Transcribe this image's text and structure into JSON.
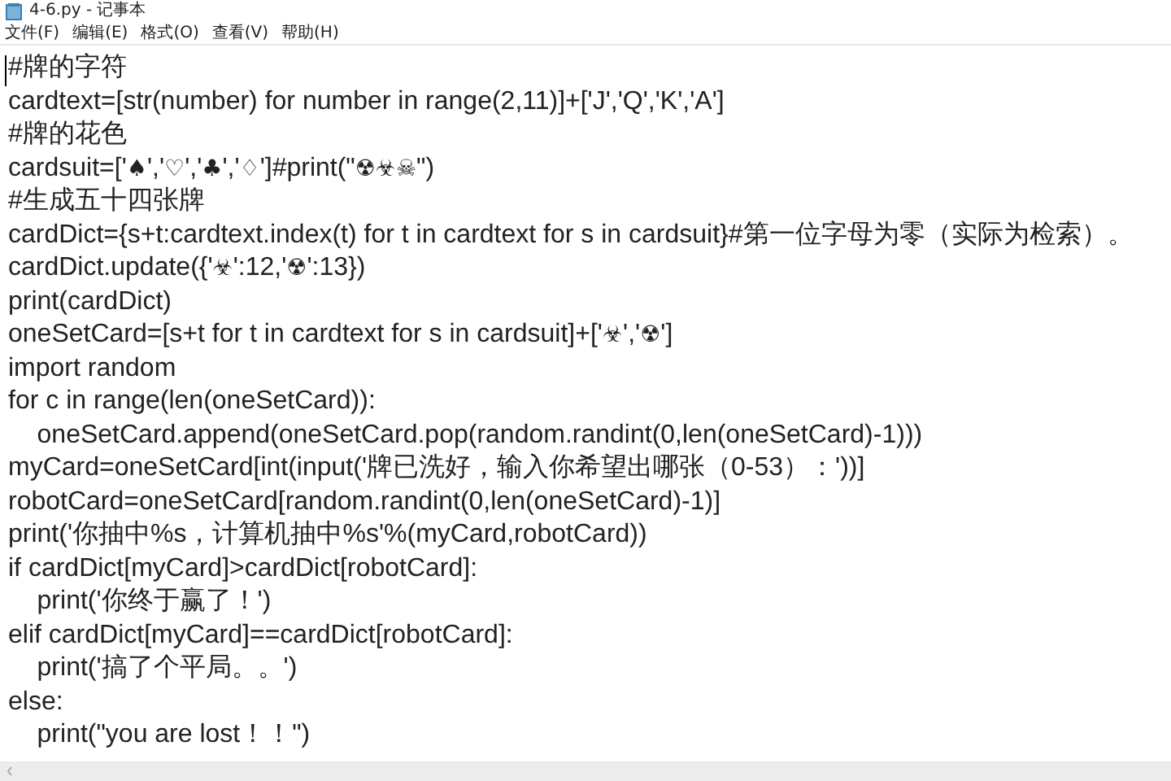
{
  "window": {
    "title": "4-6.py - 记事本"
  },
  "menu": [
    "文件(F)",
    "编辑(E)",
    "格式(O)",
    "查看(V)",
    "帮助(H)"
  ],
  "editor": {
    "lines": [
      "#牌的字符",
      "cardtext=[str(number) for number in range(2,11)]+['J','Q','K','A']",
      "#牌的花色",
      "cardsuit=['♠','♡','♣','♢']#print(\"☢☣☠\")",
      "#生成五十四张牌",
      "cardDict={s+t:cardtext.index(t) for t in cardtext for s in cardsuit}#第一位字母为零（实际为检索）。",
      "cardDict.update({'☣':12,'☢':13})",
      "print(cardDict)",
      "oneSetCard=[s+t for t in cardtext for s in cardsuit]+['☣','☢']",
      "import random",
      "for c in range(len(oneSetCard)):",
      "    oneSetCard.append(oneSetCard.pop(random.randint(0,len(oneSetCard)-1)))",
      "myCard=oneSetCard[int(input('牌已洗好，输入你希望出哪张（0-53）：'))]",
      "robotCard=oneSetCard[random.randint(0,len(oneSetCard)-1)]",
      "print('你抽中%s，计算机抽中%s'%(myCard,robotCard))",
      "if cardDict[myCard]>cardDict[robotCard]:",
      "    print('你终于赢了！')",
      "elif cardDict[myCard]==cardDict[robotCard]:",
      "    print('搞了个平局。。')",
      "else:",
      "    print(\"you are lost！！\")"
    ]
  }
}
